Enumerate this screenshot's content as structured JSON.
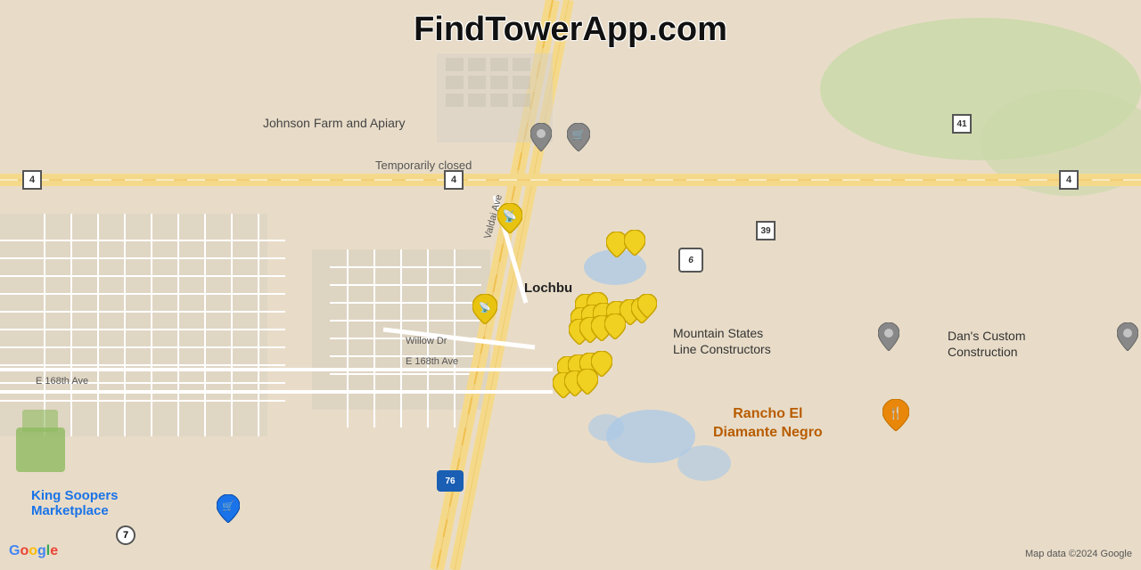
{
  "title": "FindTowerApp.com",
  "map": {
    "attribution": "Map data ©2024 Google",
    "center_city": "Lochbu",
    "businesses": [
      {
        "name": "Johnson Farm and Apiary",
        "status": "Temporarily closed"
      },
      {
        "name": "Mountain States\nLine Constructors"
      },
      {
        "name": "Dan's Custom\nConstruction"
      },
      {
        "name": "Rancho El\nDiamante Negro"
      },
      {
        "name": "King Soopers\nMarketplace"
      }
    ],
    "streets": [
      "Valdai Ave",
      "Willow Dr",
      "E 168th Ave"
    ],
    "routes": [
      "4",
      "4",
      "4",
      "39",
      "6",
      "41",
      "76",
      "7"
    ],
    "temp_closed_text": "Temporarily closed"
  },
  "google": {
    "label": "Google"
  }
}
